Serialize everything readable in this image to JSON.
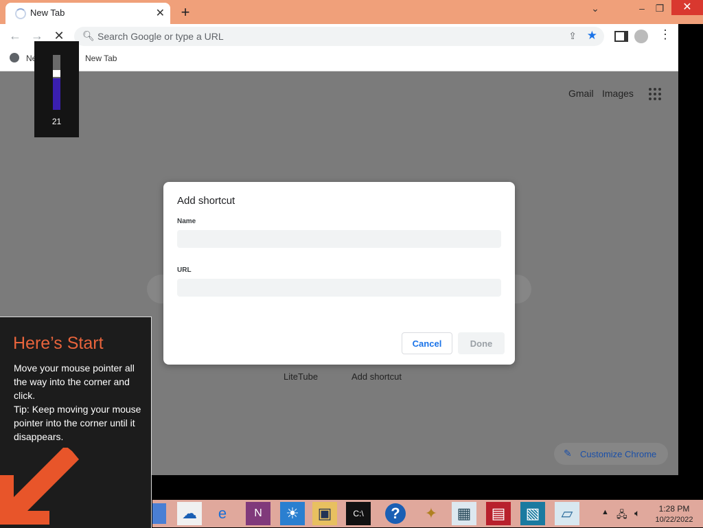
{
  "browser": {
    "tab_title": "New Tab",
    "tab_close": "✕",
    "new_tab_symbol": "+",
    "window_controls": {
      "chevron": "⌄",
      "minimize": "–",
      "restore": "❐",
      "close": "✕"
    },
    "nav": {
      "back": "←",
      "forward": "→",
      "stop": "✕"
    },
    "omnibox_placeholder": "Search Google or type a URL",
    "bookmarks": [
      "Ne",
      "New Tab"
    ],
    "accent_color": "#1a73e8"
  },
  "page": {
    "top_links": {
      "gmail": "Gmail",
      "images": "Images"
    },
    "shortcut_tiles": [
      "LiteTube",
      "Add shortcut"
    ],
    "customize_label": "Customize Chrome"
  },
  "dialog": {
    "title": "Add shortcut",
    "name_label": "Name",
    "name_value": "",
    "url_label": "URL",
    "url_value": "",
    "cancel_label": "Cancel",
    "done_label": "Done"
  },
  "volume_overlay": {
    "level": 21
  },
  "start_tip": {
    "title": "Here’s Start",
    "body": "Move your mouse pointer all the way into the corner and click.\nTip: Keep moving your mouse pointer into the corner until it disappears."
  },
  "taskbar": {
    "icons": [
      "onedrive-icon",
      "internet-explorer-icon",
      "onenote-icon",
      "weather-icon",
      "remote-desktop-icon",
      "command-prompt-icon",
      "help-icon",
      "wizard-icon",
      "resource-monitor-icon",
      "reader-icon",
      "photos-icon",
      "sticky-notes-icon"
    ],
    "time": "1:28 PM",
    "date": "10/22/2022"
  }
}
